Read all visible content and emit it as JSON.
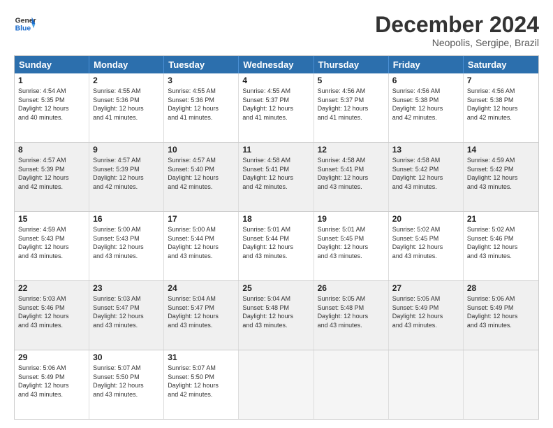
{
  "header": {
    "logo_general": "General",
    "logo_blue": "Blue",
    "month": "December 2024",
    "location": "Neopolis, Sergipe, Brazil"
  },
  "weekdays": [
    "Sunday",
    "Monday",
    "Tuesday",
    "Wednesday",
    "Thursday",
    "Friday",
    "Saturday"
  ],
  "rows": [
    [
      {
        "day": "1",
        "lines": [
          "Sunrise: 4:54 AM",
          "Sunset: 5:35 PM",
          "Daylight: 12 hours",
          "and 40 minutes."
        ]
      },
      {
        "day": "2",
        "lines": [
          "Sunrise: 4:55 AM",
          "Sunset: 5:36 PM",
          "Daylight: 12 hours",
          "and 41 minutes."
        ]
      },
      {
        "day": "3",
        "lines": [
          "Sunrise: 4:55 AM",
          "Sunset: 5:36 PM",
          "Daylight: 12 hours",
          "and 41 minutes."
        ]
      },
      {
        "day": "4",
        "lines": [
          "Sunrise: 4:55 AM",
          "Sunset: 5:37 PM",
          "Daylight: 12 hours",
          "and 41 minutes."
        ]
      },
      {
        "day": "5",
        "lines": [
          "Sunrise: 4:56 AM",
          "Sunset: 5:37 PM",
          "Daylight: 12 hours",
          "and 41 minutes."
        ]
      },
      {
        "day": "6",
        "lines": [
          "Sunrise: 4:56 AM",
          "Sunset: 5:38 PM",
          "Daylight: 12 hours",
          "and 42 minutes."
        ]
      },
      {
        "day": "7",
        "lines": [
          "Sunrise: 4:56 AM",
          "Sunset: 5:38 PM",
          "Daylight: 12 hours",
          "and 42 minutes."
        ]
      }
    ],
    [
      {
        "day": "8",
        "lines": [
          "Sunrise: 4:57 AM",
          "Sunset: 5:39 PM",
          "Daylight: 12 hours",
          "and 42 minutes."
        ]
      },
      {
        "day": "9",
        "lines": [
          "Sunrise: 4:57 AM",
          "Sunset: 5:39 PM",
          "Daylight: 12 hours",
          "and 42 minutes."
        ]
      },
      {
        "day": "10",
        "lines": [
          "Sunrise: 4:57 AM",
          "Sunset: 5:40 PM",
          "Daylight: 12 hours",
          "and 42 minutes."
        ]
      },
      {
        "day": "11",
        "lines": [
          "Sunrise: 4:58 AM",
          "Sunset: 5:41 PM",
          "Daylight: 12 hours",
          "and 42 minutes."
        ]
      },
      {
        "day": "12",
        "lines": [
          "Sunrise: 4:58 AM",
          "Sunset: 5:41 PM",
          "Daylight: 12 hours",
          "and 43 minutes."
        ]
      },
      {
        "day": "13",
        "lines": [
          "Sunrise: 4:58 AM",
          "Sunset: 5:42 PM",
          "Daylight: 12 hours",
          "and 43 minutes."
        ]
      },
      {
        "day": "14",
        "lines": [
          "Sunrise: 4:59 AM",
          "Sunset: 5:42 PM",
          "Daylight: 12 hours",
          "and 43 minutes."
        ]
      }
    ],
    [
      {
        "day": "15",
        "lines": [
          "Sunrise: 4:59 AM",
          "Sunset: 5:43 PM",
          "Daylight: 12 hours",
          "and 43 minutes."
        ]
      },
      {
        "day": "16",
        "lines": [
          "Sunrise: 5:00 AM",
          "Sunset: 5:43 PM",
          "Daylight: 12 hours",
          "and 43 minutes."
        ]
      },
      {
        "day": "17",
        "lines": [
          "Sunrise: 5:00 AM",
          "Sunset: 5:44 PM",
          "Daylight: 12 hours",
          "and 43 minutes."
        ]
      },
      {
        "day": "18",
        "lines": [
          "Sunrise: 5:01 AM",
          "Sunset: 5:44 PM",
          "Daylight: 12 hours",
          "and 43 minutes."
        ]
      },
      {
        "day": "19",
        "lines": [
          "Sunrise: 5:01 AM",
          "Sunset: 5:45 PM",
          "Daylight: 12 hours",
          "and 43 minutes."
        ]
      },
      {
        "day": "20",
        "lines": [
          "Sunrise: 5:02 AM",
          "Sunset: 5:45 PM",
          "Daylight: 12 hours",
          "and 43 minutes."
        ]
      },
      {
        "day": "21",
        "lines": [
          "Sunrise: 5:02 AM",
          "Sunset: 5:46 PM",
          "Daylight: 12 hours",
          "and 43 minutes."
        ]
      }
    ],
    [
      {
        "day": "22",
        "lines": [
          "Sunrise: 5:03 AM",
          "Sunset: 5:46 PM",
          "Daylight: 12 hours",
          "and 43 minutes."
        ]
      },
      {
        "day": "23",
        "lines": [
          "Sunrise: 5:03 AM",
          "Sunset: 5:47 PM",
          "Daylight: 12 hours",
          "and 43 minutes."
        ]
      },
      {
        "day": "24",
        "lines": [
          "Sunrise: 5:04 AM",
          "Sunset: 5:47 PM",
          "Daylight: 12 hours",
          "and 43 minutes."
        ]
      },
      {
        "day": "25",
        "lines": [
          "Sunrise: 5:04 AM",
          "Sunset: 5:48 PM",
          "Daylight: 12 hours",
          "and 43 minutes."
        ]
      },
      {
        "day": "26",
        "lines": [
          "Sunrise: 5:05 AM",
          "Sunset: 5:48 PM",
          "Daylight: 12 hours",
          "and 43 minutes."
        ]
      },
      {
        "day": "27",
        "lines": [
          "Sunrise: 5:05 AM",
          "Sunset: 5:49 PM",
          "Daylight: 12 hours",
          "and 43 minutes."
        ]
      },
      {
        "day": "28",
        "lines": [
          "Sunrise: 5:06 AM",
          "Sunset: 5:49 PM",
          "Daylight: 12 hours",
          "and 43 minutes."
        ]
      }
    ],
    [
      {
        "day": "29",
        "lines": [
          "Sunrise: 5:06 AM",
          "Sunset: 5:49 PM",
          "Daylight: 12 hours",
          "and 43 minutes."
        ]
      },
      {
        "day": "30",
        "lines": [
          "Sunrise: 5:07 AM",
          "Sunset: 5:50 PM",
          "Daylight: 12 hours",
          "and 43 minutes."
        ]
      },
      {
        "day": "31",
        "lines": [
          "Sunrise: 5:07 AM",
          "Sunset: 5:50 PM",
          "Daylight: 12 hours",
          "and 42 minutes."
        ]
      },
      {
        "day": "",
        "lines": []
      },
      {
        "day": "",
        "lines": []
      },
      {
        "day": "",
        "lines": []
      },
      {
        "day": "",
        "lines": []
      }
    ]
  ]
}
